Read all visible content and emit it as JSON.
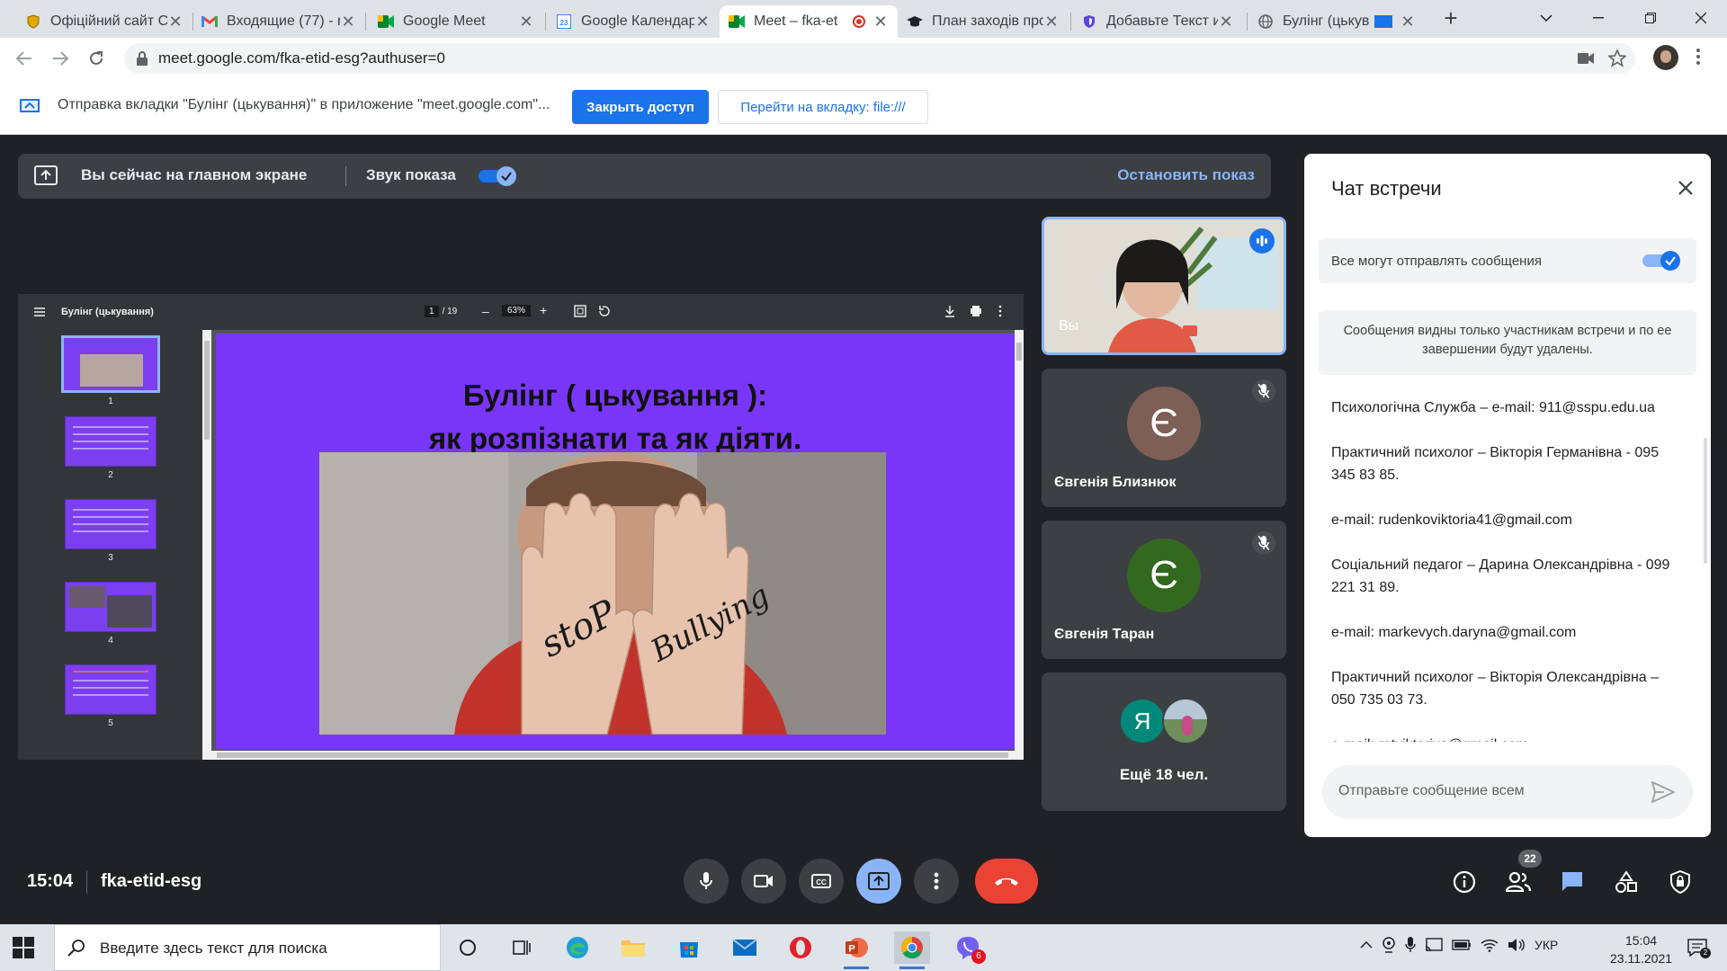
{
  "browser": {
    "tabs": [
      {
        "title": "Офіційний сайт С",
        "favicon": "shield-icon",
        "active": false
      },
      {
        "title": "Входящие (77) - r",
        "favicon": "gmail-icon",
        "active": false
      },
      {
        "title": "Google Meet",
        "favicon": "meet-icon",
        "active": false
      },
      {
        "title": "Google Календар",
        "favicon": "calendar-icon",
        "active": false
      },
      {
        "title": "Meet – fka-et",
        "favicon": "meet-icon",
        "active": true,
        "recording": true
      },
      {
        "title": "План заходів про",
        "favicon": "graduation-cap-icon",
        "active": false
      },
      {
        "title": "Добавьте Текст и",
        "favicon": "shield-purple-icon",
        "active": false
      },
      {
        "title": "Булінг (цькув",
        "favicon": "globe-icon",
        "active": false,
        "casting": true
      }
    ],
    "new_tab": "+",
    "url": "meet.google.com/fka-etid-esg?authuser=0"
  },
  "infobar": {
    "text": "Отправка вкладки \"Булінг (цькування)\" в приложение \"meet.google.com\"...",
    "close_access": "Закрыть доступ",
    "go_to_tab": "Перейти на вкладку: file:///"
  },
  "presenting": {
    "main_screen": "Вы сейчас на главном экране",
    "sound": "Звук показа",
    "stop": "Остановить показ"
  },
  "pdf": {
    "title": "Булінг (цькування)",
    "page_current": "1",
    "page_total": "/ 19",
    "zoom": "63%",
    "thumbnails": [
      "1",
      "2",
      "3",
      "4",
      "5"
    ],
    "slide_title_line1": "Булінг ( цькування ):",
    "slide_title_line2": "як розпізнати та як діяти.",
    "photo_text_left": "stoP",
    "photo_text_right": "Bullying"
  },
  "participants": [
    {
      "name": "Вы",
      "type": "self"
    },
    {
      "name": "Євгенія Близнюк",
      "initial": "Є",
      "color": "#7d5f55"
    },
    {
      "name": "Євгенія Таран",
      "initial": "Є",
      "color": "#33691e"
    },
    {
      "name": "Ещё 18 чел.",
      "initial": "Я",
      "color": "#00897b"
    }
  ],
  "chat": {
    "title": "Чат встречи",
    "permission_label": "Все могут отправлять сообщения",
    "note": "Сообщения видны только участникам встречи и по ее завершении будут удалены.",
    "messages": [
      "Психологічна Служба – e-mail: 911@sspu.edu.ua",
      "Практичний психолог – Вікторія Германівна - 095 345 83 85.",
      "e-mail: rudenkoviktoria41@gmail.com",
      "Соціальний педагог – Дарина Олександрівна - 099 221 31 89.",
      "e-mail: markevych.daryna@gmail.com",
      "Практичний психолог – Вікторія Олександрівна – 050 735 03 73.",
      "e-mail: rotviktoriya@gmail.com"
    ],
    "input_placeholder": "Отправьте сообщение всем"
  },
  "meeting": {
    "time": "15:04",
    "code": "fka-etid-esg",
    "people_count": "22"
  },
  "taskbar": {
    "search_placeholder": "Введите здесь текст для поиска",
    "language": "УКР",
    "time": "15:04",
    "date": "23.11.2021",
    "viber_badge": "6"
  },
  "colors": {
    "meet_bg": "#202124",
    "tile_bg": "#3c4043",
    "accent_blue": "#1a73e8",
    "light_blue": "#8ab4f8",
    "hangup_red": "#ea4335",
    "slide_purple": "#7a36f8"
  }
}
